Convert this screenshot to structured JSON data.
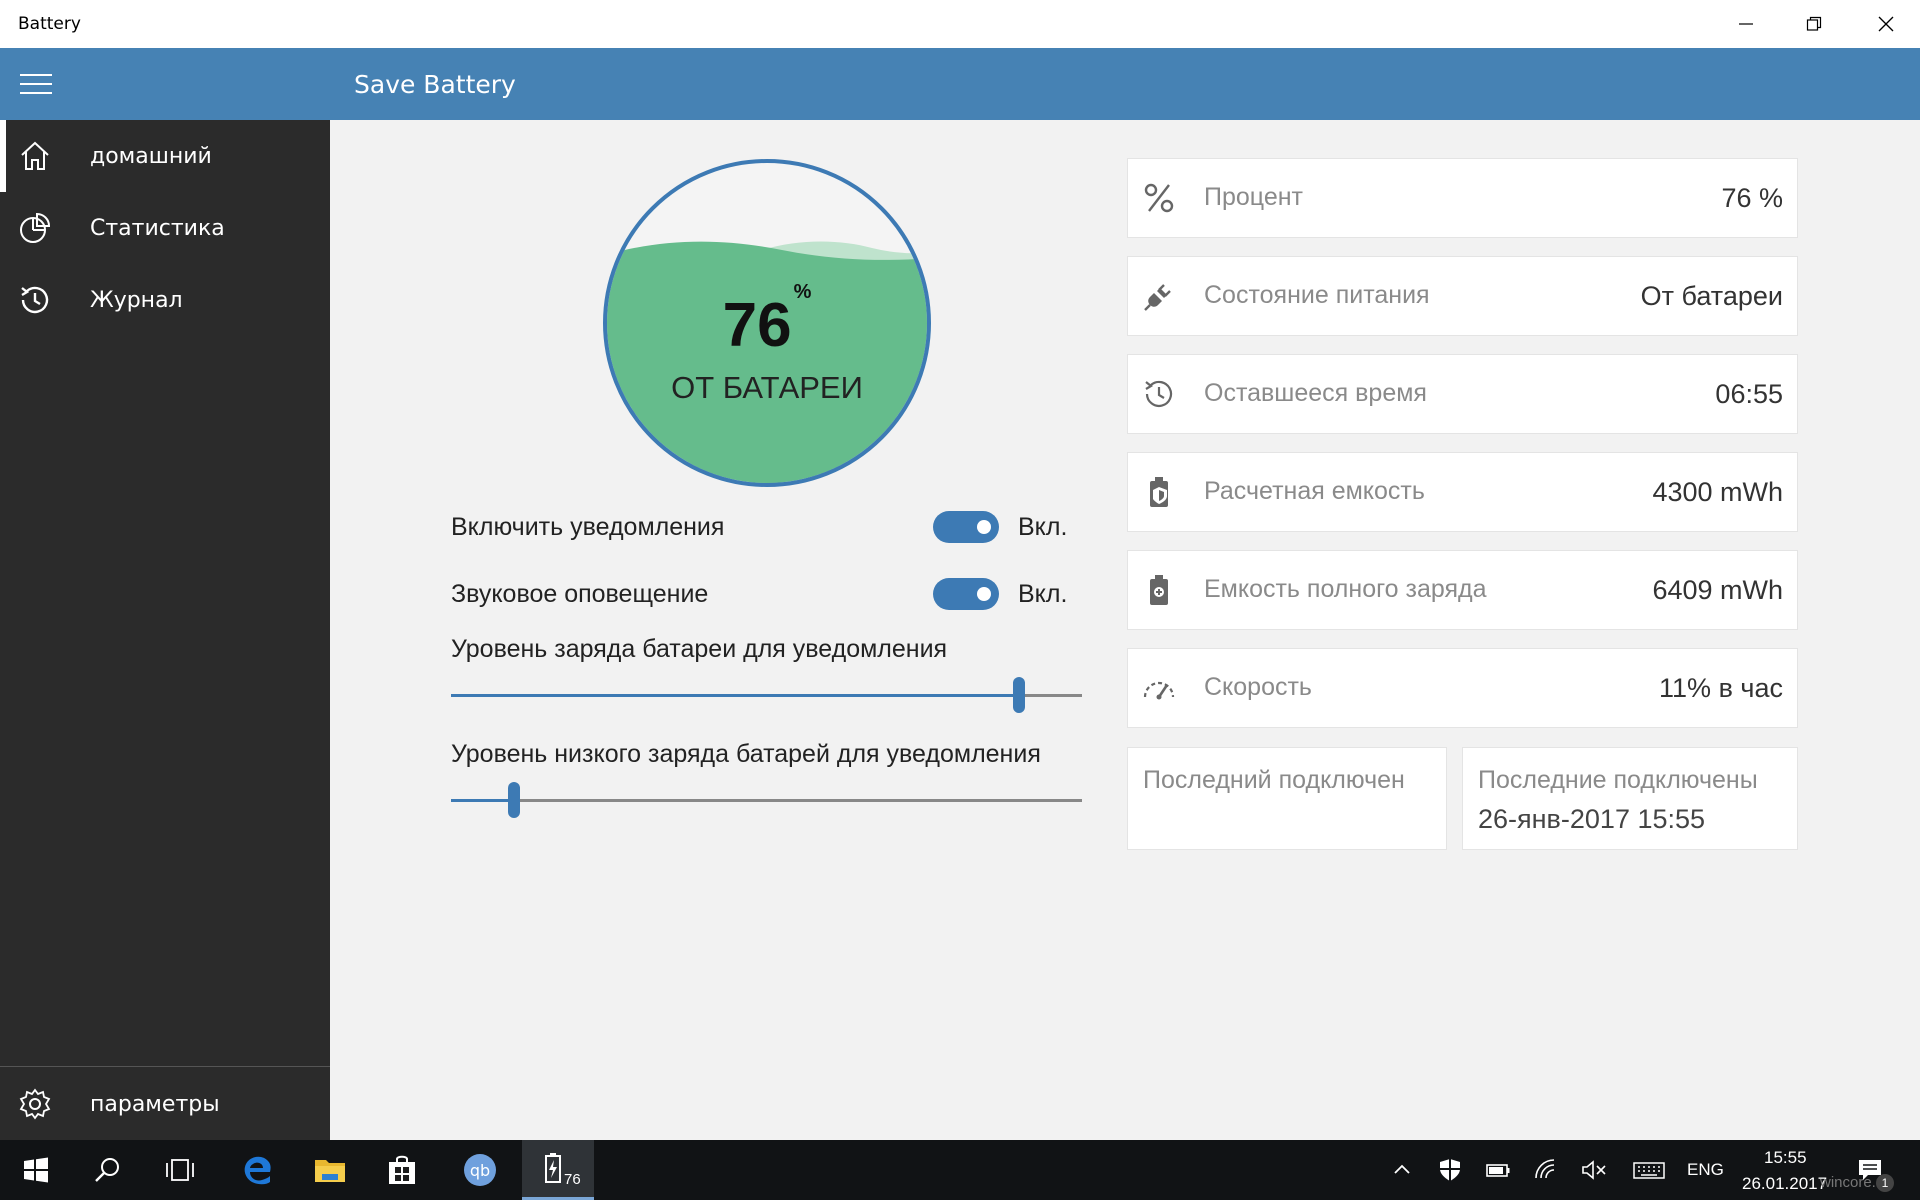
{
  "window": {
    "title": "Battery"
  },
  "header": {
    "app_title": "Save Battery"
  },
  "sidebar": {
    "items": [
      {
        "label": "домашний",
        "icon": "home-icon",
        "active": true
      },
      {
        "label": "Статистика",
        "icon": "pie-chart-icon"
      },
      {
        "label": "Журнал",
        "icon": "history-icon"
      }
    ],
    "settings_label": "параметры"
  },
  "gauge": {
    "value": "76",
    "unit": "%",
    "state": "ОТ БАТАРЕИ",
    "fill_color": "#65bc8c",
    "border_color": "#3d7ab4"
  },
  "settings": {
    "notifications": {
      "label": "Включить уведомления",
      "state": "Вкл."
    },
    "sound": {
      "label": "Звуковое оповещение",
      "state": "Вкл."
    },
    "charge_level": {
      "label": "Уровень заряда батареи для уведомления",
      "fraction": 0.9
    },
    "low_level": {
      "label": "Уровень низкого заряда батарей для уведомления",
      "fraction": 0.1
    }
  },
  "info": {
    "percent": {
      "label": "Процент",
      "value": "76 %",
      "icon": "percent-icon"
    },
    "power_state": {
      "label": "Состояние питания",
      "value": "От батареи",
      "icon": "plug-icon"
    },
    "remaining": {
      "label": "Оставшееся время",
      "value": "06:55",
      "icon": "clock-icon"
    },
    "design_capacity": {
      "label": "Расчетная емкость",
      "value": "4300 mWh",
      "icon": "battery-shield-icon"
    },
    "full_capacity": {
      "label": "Емкость полного заряда",
      "value": "6409 mWh",
      "icon": "battery-plus-icon"
    },
    "rate": {
      "label": "Скорость",
      "value": "11% в час",
      "icon": "speedometer-icon"
    },
    "last_connected": {
      "label": "Последний подключен",
      "value": ""
    },
    "last_connected_alt": {
      "label": "Последние подключены",
      "value": "26-янв-2017 15:55"
    }
  },
  "taskbar": {
    "language": "ENG",
    "time": "15:55",
    "date": "26.01.2017",
    "battery_badge": "76",
    "notification_count": "1",
    "watermark": "wincore.ru"
  },
  "colors": {
    "accent": "#4682b4",
    "sidebar": "#2b2b2b",
    "toggle": "#3d7ab4"
  }
}
